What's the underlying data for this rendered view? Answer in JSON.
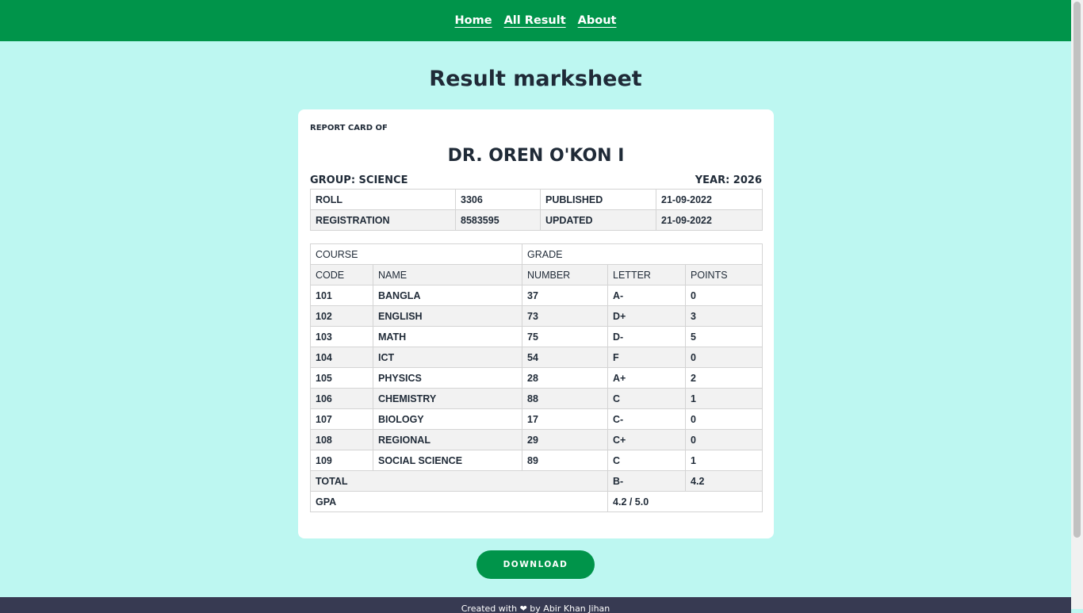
{
  "nav": {
    "home": "Home",
    "all_result": "All Result",
    "about": "About"
  },
  "page_title": "Result marksheet",
  "card": {
    "label": "REPORT CARD OF",
    "student_name": "DR. OREN O'KON I",
    "group": "GROUP: SCIENCE",
    "year": "YEAR: 2026"
  },
  "info": {
    "roll_label": "ROLL",
    "roll_value": "3306",
    "published_label": "PUBLISHED",
    "published_value": "21-09-2022",
    "registration_label": "REGISTRATION",
    "registration_value": "8583595",
    "updated_label": "UPDATED",
    "updated_value": "21-09-2022"
  },
  "results": {
    "course_header": "COURSE",
    "grade_header": "GRADE",
    "columns": [
      "CODE",
      "NAME",
      "NUMBER",
      "LETTER",
      "POINTS"
    ],
    "rows": [
      [
        "101",
        "BANGLA",
        "37",
        "A-",
        "0"
      ],
      [
        "102",
        "ENGLISH",
        "73",
        "D+",
        "3"
      ],
      [
        "103",
        "MATH",
        "75",
        "D-",
        "5"
      ],
      [
        "104",
        "ICT",
        "54",
        "F",
        "0"
      ],
      [
        "105",
        "PHYSICS",
        "28",
        "A+",
        "2"
      ],
      [
        "106",
        "CHEMISTRY",
        "88",
        "C",
        "1"
      ],
      [
        "107",
        "BIOLOGY",
        "17",
        "C-",
        "0"
      ],
      [
        "108",
        "REGIONAL",
        "29",
        "C+",
        "0"
      ],
      [
        "109",
        "SOCIAL SCIENCE",
        "89",
        "C",
        "1"
      ]
    ],
    "total_label": "TOTAL",
    "total_letter": "B-",
    "total_points": "4.2",
    "gpa_label": "GPA",
    "gpa_value": "4.2 / 5.0"
  },
  "download_label": "DOWNLOAD",
  "footer_text": "Created with ❤ by Abir Khan Jihan",
  "colors": {
    "accent": "#00944a",
    "background": "#bdf7f1",
    "footer": "#373a52"
  }
}
